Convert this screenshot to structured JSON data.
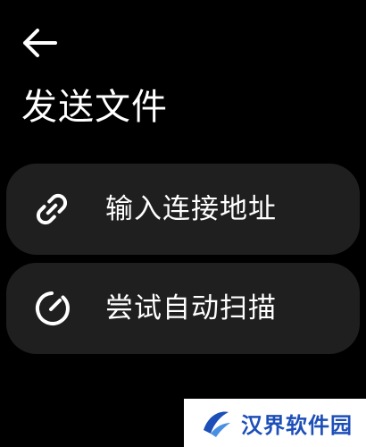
{
  "header": {
    "back_icon": "arrow-left-icon",
    "title": "发送文件"
  },
  "menu": {
    "items": [
      {
        "label": "输入连接地址",
        "icon": "link-icon"
      },
      {
        "label": "尝试自动扫描",
        "icon": "scan-icon"
      }
    ]
  },
  "watermark": {
    "text": "汉界软件园"
  },
  "colors": {
    "background": "#000000",
    "card": "#1f1f1f",
    "text": "#ffffff",
    "watermark_text": "#1d4fb8"
  }
}
